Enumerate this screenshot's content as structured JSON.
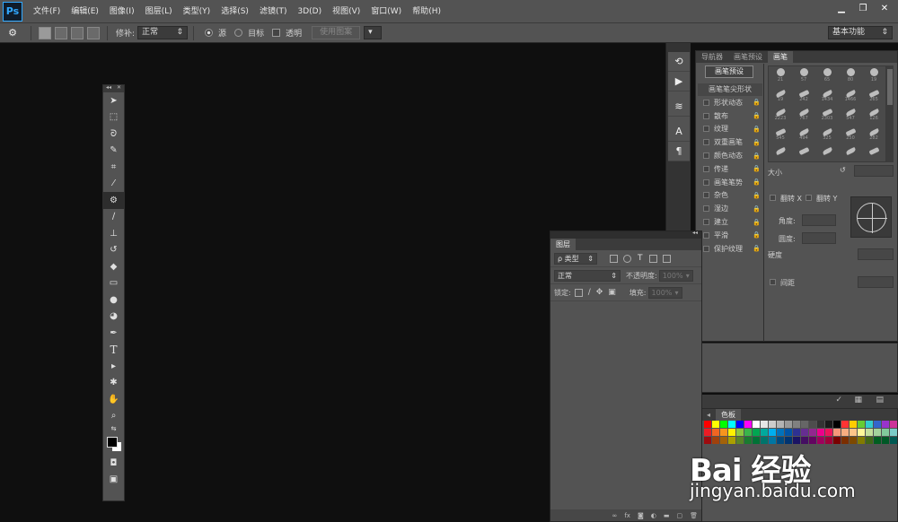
{
  "app": {
    "logo": "Ps"
  },
  "menu": [
    "文件(F)",
    "编辑(E)",
    "图像(I)",
    "图层(L)",
    "类型(Y)",
    "选择(S)",
    "滤镜(T)",
    "3D(D)",
    "视图(V)",
    "窗口(W)",
    "帮助(H)"
  ],
  "window_controls": {
    "minimize": "▁",
    "restore": "❐",
    "close": "✕"
  },
  "options": {
    "patch_label": "修补:",
    "patch_mode": "正常",
    "source_label": "源",
    "target_label": "目标",
    "transparent_label": "透明",
    "use_pattern_button": "使用图案",
    "workspace": "基本功能"
  },
  "toolbox": {
    "tools": [
      "move-tool",
      "marquee-tool",
      "lasso-tool",
      "quick-select-tool",
      "crop-tool",
      "eyedropper-tool",
      "patch-tool",
      "brush-tool",
      "stamp-tool",
      "history-brush-tool",
      "eraser-tool",
      "gradient-tool",
      "blur-tool",
      "dodge-tool",
      "pen-tool",
      "type-tool",
      "path-select-tool",
      "shape-tool",
      "hand-tool",
      "zoom-tool"
    ],
    "type_glyph": "T",
    "active_tool": "patch-tool"
  },
  "dock_icon_text": {
    "char": "A",
    "para": "¶"
  },
  "brush_panel": {
    "tabs": [
      "导航器",
      "画笔预设",
      "画笔"
    ],
    "active_tab": "画笔",
    "preset_button": "画笔预设",
    "tip_shape_header": "画笔笔尖形状",
    "options": [
      "形状动态",
      "散布",
      "纹理",
      "双重画笔",
      "颜色动态",
      "传递",
      "画笔笔势",
      "杂色",
      "湿边",
      "建立",
      "平滑",
      "保护纹理"
    ],
    "brush_sizes": [
      "21",
      "57",
      "65",
      "80",
      "19",
      "19",
      "242",
      "1434",
      "1466",
      "265",
      "2223",
      "767",
      "2303",
      "547",
      "126",
      "545",
      "494",
      "325",
      "250",
      "282",
      "",
      "",
      "",
      "",
      ""
    ],
    "size_label": "大小",
    "flip_x_label": "翻转 X",
    "flip_y_label": "翻转 Y",
    "angle_label": "角度:",
    "roundness_label": "圆度:",
    "hardness_label": "硬度",
    "spacing_label": "间距"
  },
  "layers_panel": {
    "title": "图层",
    "filter_type": "ρ 类型",
    "blend_mode": "正常",
    "opacity_label": "不透明度:",
    "opacity_value": "100%",
    "lock_label": "锁定:",
    "fill_label": "填充:",
    "fill_value": "100%",
    "fx_label": "fx"
  },
  "swatches_panel": {
    "title": "色板",
    "colors": [
      "#ff0000",
      "#ffff00",
      "#00ff00",
      "#00ffff",
      "#0000ff",
      "#ff00ff",
      "#ffffff",
      "#e6e6e6",
      "#cccccc",
      "#b3b3b3",
      "#999999",
      "#808080",
      "#666666",
      "#4d4d4d",
      "#333333",
      "#1a1a1a",
      "#000000",
      "#ff3333",
      "#ffcc00",
      "#66cc33",
      "#33cccc",
      "#3366cc",
      "#9933cc",
      "#cc3399",
      "#ed1c24",
      "#f26522",
      "#f7941d",
      "#fff200",
      "#8dc63f",
      "#39b54a",
      "#00a651",
      "#00a99d",
      "#00aeef",
      "#0072bc",
      "#0054a6",
      "#2e3192",
      "#662d91",
      "#92278f",
      "#ec008c",
      "#ed145b",
      "#f69679",
      "#f9ad81",
      "#fdc689",
      "#fff799",
      "#c4df9b",
      "#a3d39c",
      "#82ca9c",
      "#7accc8",
      "#9e0b0f",
      "#a0410d",
      "#a36209",
      "#aba000",
      "#598527",
      "#1a7b30",
      "#007236",
      "#00746b",
      "#0076a3",
      "#004a80",
      "#003471",
      "#1b1464",
      "#440e62",
      "#630460",
      "#9e005d",
      "#9e0039",
      "#790000",
      "#7b2e00",
      "#7d4900",
      "#827b00",
      "#406618",
      "#005e20",
      "#005826",
      "#005952"
    ]
  },
  "watermark": {
    "logo": "Bai 经验",
    "url": "jingyan.baidu.com"
  }
}
